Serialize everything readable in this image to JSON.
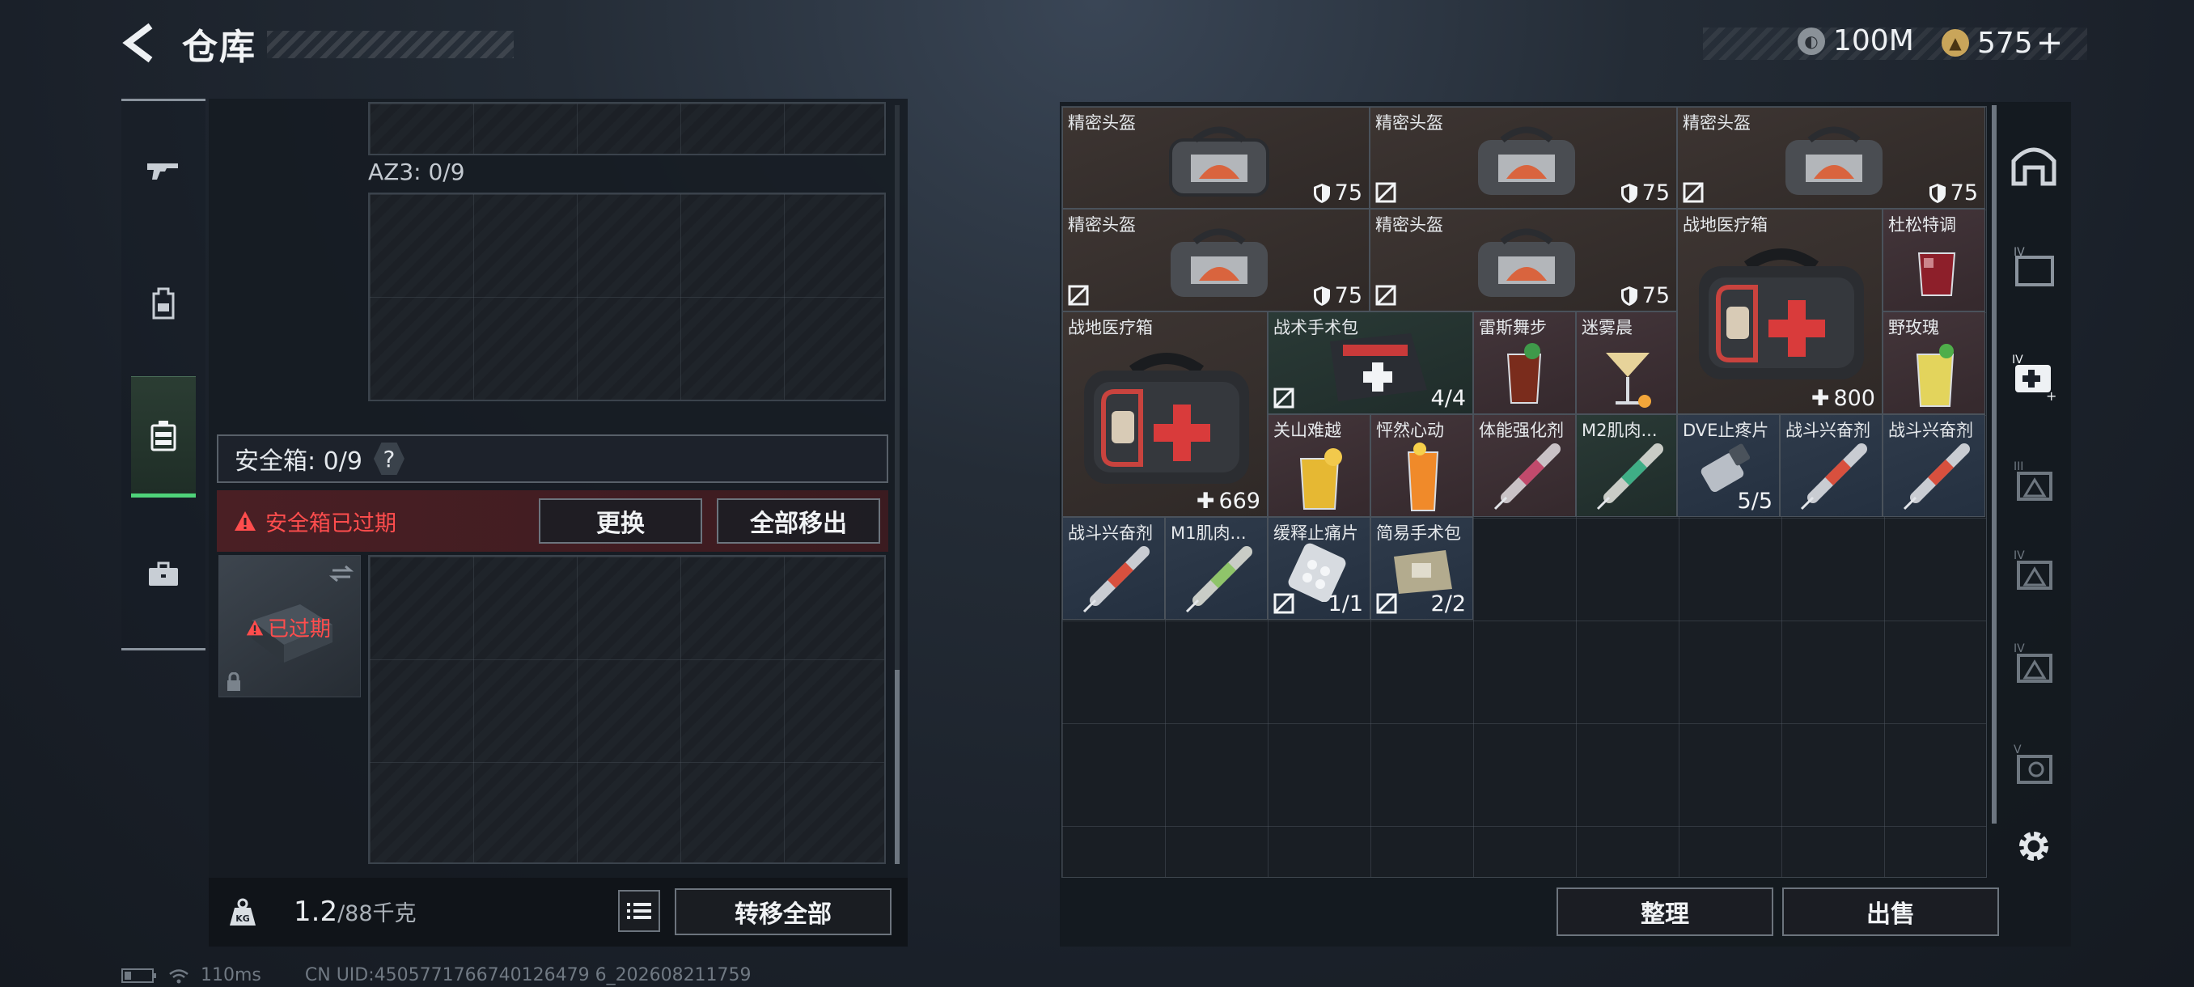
{
  "header": {
    "title": "仓库"
  },
  "currencies": [
    {
      "icon": "silver-coin-icon",
      "value": "100M"
    },
    {
      "icon": "gold-coin-icon",
      "value": "575",
      "plus": "+"
    }
  ],
  "left_nav": [
    {
      "icon": "gun-icon",
      "active": false
    },
    {
      "icon": "backpack-icon",
      "active": false
    },
    {
      "icon": "safe-case-icon",
      "active": true
    },
    {
      "icon": "briefcase-icon",
      "active": false
    }
  ],
  "left_panel": {
    "az_label": "AZ3: 0/9",
    "safe_box_label": "安全箱: 0/9",
    "help": "?",
    "warning": "安全箱已过期",
    "replace_button": "更换",
    "remove_all_button": "全部移出",
    "expired_label": "已过期",
    "weight_current": "1.2",
    "weight_max": "/88千克",
    "transfer_all_button": "转移全部"
  },
  "items": [
    {
      "name": "精密头盔",
      "value": "75"
    },
    {
      "name": "精密头盔",
      "value": "75"
    },
    {
      "name": "精密头盔",
      "value": "75"
    },
    {
      "name": "精密头盔",
      "value": "75"
    },
    {
      "name": "精密头盔",
      "value": "75"
    },
    {
      "name": "战地医疗箱",
      "value": "800"
    },
    {
      "name": "杜松特调"
    },
    {
      "name": "战地医疗箱",
      "value": "669"
    },
    {
      "name": "战术手术包",
      "value": "4/4"
    },
    {
      "name": "雷斯舞步"
    },
    {
      "name": "迷雾晨"
    },
    {
      "name": "野玫瑰"
    },
    {
      "name": "关山难越"
    },
    {
      "name": "怦然心动"
    },
    {
      "name": "体能强化剂"
    },
    {
      "name": "M2肌肉..."
    },
    {
      "name": "DVE止疼片",
      "value": "5/5"
    },
    {
      "name": "战斗兴奋剂"
    },
    {
      "name": "战斗兴奋剂"
    },
    {
      "name": "战斗兴奋剂"
    },
    {
      "name": "M1肌肉..."
    },
    {
      "name": "缓释止痛片",
      "value": "1/1"
    },
    {
      "name": "简易手术包",
      "value": "2/2"
    }
  ],
  "right_panel": {
    "organize_button": "整理",
    "sell_button": "出售"
  },
  "status": {
    "ping": "110ms",
    "uid": "CN UID:4505771766740126479 6_202608211759"
  }
}
